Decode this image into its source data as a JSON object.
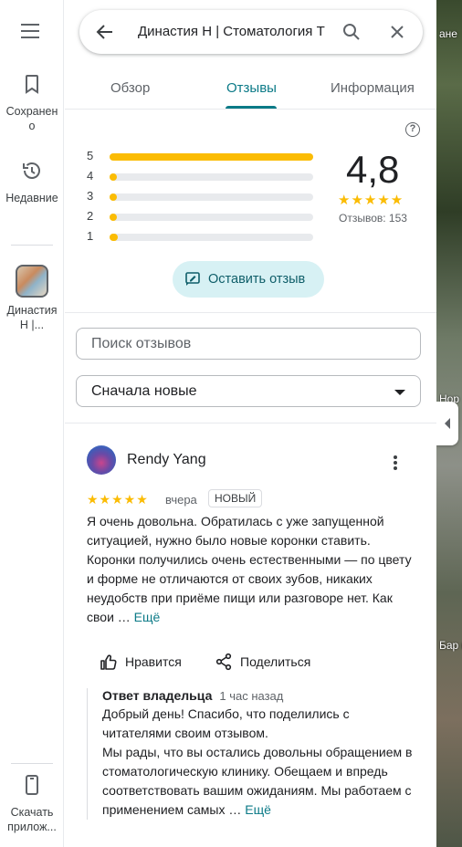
{
  "rail": {
    "saved_label": "Сохранено",
    "recent_label": "Недавние",
    "place_label": "Династия Н |...",
    "download_label": "Скачать прилож..."
  },
  "search": {
    "query": "Династия Н | Стоматология Т"
  },
  "tabs": [
    {
      "label": "Обзор"
    },
    {
      "label": "Отзывы"
    },
    {
      "label": "Информация"
    }
  ],
  "rating": {
    "histogram": [
      {
        "stars": "5",
        "fraction": 1.0
      },
      {
        "stars": "4",
        "fraction": 0.01
      },
      {
        "stars": "3",
        "fraction": 0.01
      },
      {
        "stars": "2",
        "fraction": 0.02
      },
      {
        "stars": "1",
        "fraction": 0.04
      }
    ],
    "average": "4,8",
    "stars": "★★★★★",
    "count": "Отзывов: 153"
  },
  "write_review_label": "Оставить отзыв",
  "search_reviews_placeholder": "Поиск отзывов",
  "sort_label": "Сначала новые",
  "review": {
    "author": "Rendy Yang",
    "stars": "★★★★★",
    "date": "вчера",
    "badge": "НОВЫЙ",
    "text": "Я очень довольна. Обратилась с уже запущенной ситуацией, нужно было новые коронки ставить. Коронки получились очень естественными — по цвету и форме не отличаются от своих зубов, никаких неудобств при приёме пищи или разговоре нет. Как свои …",
    "more": "Ещё",
    "like_label": "Нравится",
    "share_label": "Поделиться",
    "reply": {
      "who": "Ответ владельца",
      "when": "1 час назад",
      "text": "Добрый день! Спасибо, что поделились с читателями своим отзывом.\nМы рады, что вы остались довольны обращением в стоматологическую клинику. Обещаем и впредь соответствовать вашим ожиданиям. Мы работаем с применением самых …",
      "more": "Ещё"
    }
  },
  "map": {
    "labels": [
      "ане",
      "Нор",
      "Бар клі"
    ]
  },
  "colors": {
    "accent": "#0b7a87",
    "star": "#fbbc04",
    "button_bg": "#d7f1f4"
  }
}
